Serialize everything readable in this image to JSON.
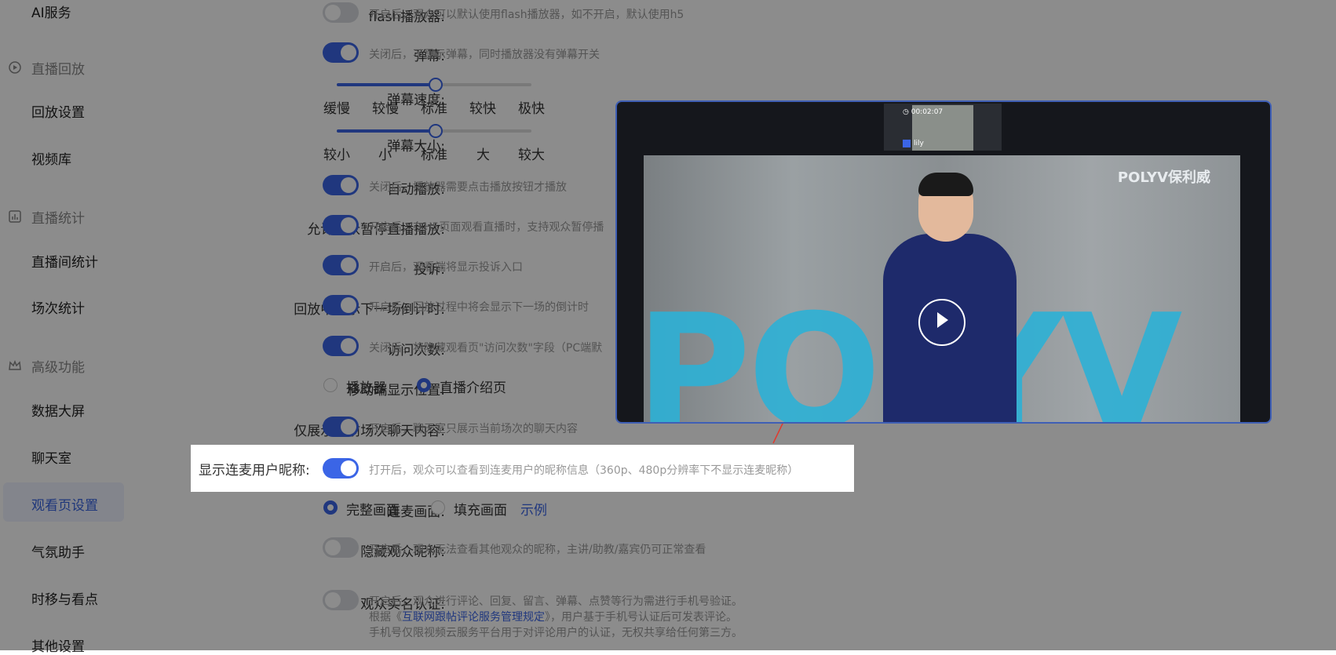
{
  "sidebar": {
    "items": [
      {
        "label": "AI服务",
        "group": false
      },
      {
        "label": "直播回放",
        "group": true,
        "icon": "playback-icon"
      },
      {
        "label": "回放设置",
        "group": false
      },
      {
        "label": "视频库",
        "group": false
      },
      {
        "label": "直播统计",
        "group": true,
        "icon": "stats-icon"
      },
      {
        "label": "直播间统计",
        "group": false
      },
      {
        "label": "场次统计",
        "group": false
      },
      {
        "label": "高级功能",
        "group": true,
        "icon": "crown-icon"
      },
      {
        "label": "数据大屏",
        "group": false
      },
      {
        "label": "聊天室",
        "group": false
      },
      {
        "label": "观看页设置",
        "group": false,
        "active": true
      },
      {
        "label": "气氛助手",
        "group": false
      },
      {
        "label": "时移与看点",
        "group": false
      },
      {
        "label": "其他设置",
        "group": false
      }
    ]
  },
  "settings": {
    "flash": {
      "label": "flash播放器:",
      "on": false,
      "desc": "开启后，观众可以默认使用flash播放器，如不开启，默认使用h5"
    },
    "danmu": {
      "label": "弹幕:",
      "on": true,
      "desc": "关闭后，不显示弹幕，同时播放器没有弹幕开关"
    },
    "danmu_speed": {
      "label": "弹幕速度:",
      "ticks": [
        "缓慢",
        "较慢",
        "标准",
        "较快",
        "极快"
      ],
      "value": "标准"
    },
    "danmu_size": {
      "label": "弹幕大小:",
      "ticks": [
        "较小",
        "小",
        "标准",
        "大",
        "较大"
      ],
      "value": "标准"
    },
    "autoplay": {
      "label": "自动播放:",
      "on": true,
      "desc": "关闭后，播放器需要点击播放按钮才播放"
    },
    "allow_pause": {
      "label": "允许观众暂停直播播放:",
      "on": true,
      "desc": "开启后，在H5页面观看直播时，支持观众暂停播"
    },
    "complaint": {
      "label": "投诉:",
      "on": true,
      "desc": "开启后，观看端将显示投诉入口"
    },
    "countdown": {
      "label": "回放中显示下一场倒计时:",
      "on": true,
      "desc": "开启后，回放过程中将会显示下一场的倒计时"
    },
    "visits": {
      "label": "访问次数:",
      "on": true,
      "desc": "关闭后，将隐藏观看页\"访问次数\"字段（PC端默"
    },
    "mobile_pos": {
      "label": "移动端显示位置:",
      "options": [
        "播放器",
        "直播介绍页"
      ],
      "selected": "直播介绍页"
    },
    "current_chat": {
      "label": "仅展示当前场次聊天内容:",
      "on": true,
      "desc": "开启后，聊天室只展示当前场次的聊天内容"
    },
    "mic_nickname": {
      "label": "显示连麦用户昵称:",
      "on": true,
      "desc": "打开后，观众可以查看到连麦用户的昵称信息（360p、480p分辨率下不显示连麦昵称）"
    },
    "mic_view": {
      "label": "连麦画面:",
      "options": [
        "完整画面",
        "填充画面"
      ],
      "selected": "完整画面",
      "link": "示例"
    },
    "hide_nick": {
      "label": "隐藏观众昵称:",
      "on": false,
      "desc": "开启后，观众无法查看其他观众的昵称，主讲/助教/嘉宾仍可正常查看"
    },
    "realname": {
      "label": "观众实名认证:",
      "on": false,
      "desc1": "开启后，观众进行评论、回复、留言、弹幕、点赞等行为需进行手机号验证。",
      "desc2_pre": "根据《",
      "desc2_link": "互联网跟帖评论服务管理规定",
      "desc2_post": "》，用户基于手机号认证后可发表评论。",
      "desc3": "手机号仅限视频云服务平台用于对评论用户的认证，无权共享给任何第三方。"
    }
  },
  "preview": {
    "thumb_time": "00:02:07",
    "thumb_user": "lily",
    "watermark": "POLYV保利威",
    "bg_text": "POLYV"
  },
  "colors": {
    "accent": "#3b65e6",
    "overlay": "rgba(0,0,0,0.45)"
  }
}
